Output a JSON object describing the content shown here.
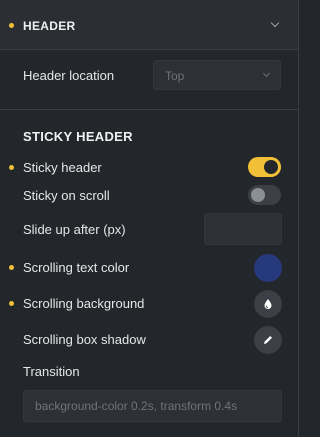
{
  "header": {
    "title": "HEADER"
  },
  "location": {
    "label": "Header location",
    "value": "Top"
  },
  "sticky": {
    "title": "STICKY HEADER",
    "sticky_header": {
      "label": "Sticky header",
      "enabled": true
    },
    "sticky_on_scroll": {
      "label": "Sticky on scroll",
      "enabled": false
    },
    "slide_up": {
      "label": "Slide up after (px)",
      "value": ""
    },
    "scrolling_text_color": {
      "label": "Scrolling text color",
      "color": "#253a7c"
    },
    "scrolling_background": {
      "label": "Scrolling background",
      "icon": "droplet-icon"
    },
    "scrolling_box_shadow": {
      "label": "Scrolling box shadow",
      "icon": "pencil-icon"
    },
    "transition": {
      "label": "Transition",
      "placeholder": "background-color 0.2s, transform 0.4s"
    }
  },
  "colors": {
    "accent": "#f2c037",
    "background": "#23262b"
  }
}
